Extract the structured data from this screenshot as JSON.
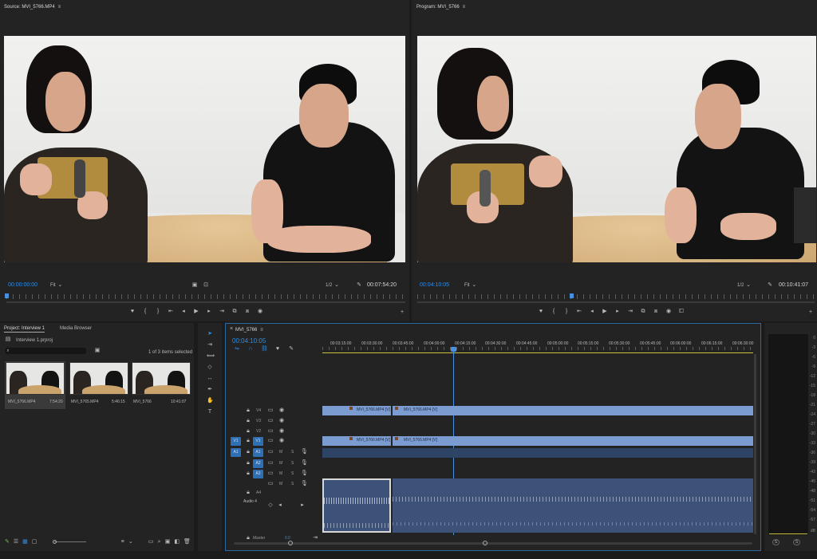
{
  "source": {
    "title": "Source: MVI_5766.MP4",
    "menu_icon": "hamburger-icon",
    "timecode": "00:00:00:00",
    "fit": "Fit",
    "resolution": "1/2",
    "duration": "00:07:54:20"
  },
  "program": {
    "title": "Program: MVI_5766",
    "menu_icon": "hamburger-icon",
    "timecode": "00:04:10:05",
    "fit": "Fit",
    "resolution": "1/2",
    "duration": "00:10:41:07"
  },
  "project": {
    "tab_project": "Project: Interview 1",
    "tab_media": "Media Browser",
    "filename": "Interview 1.prproj",
    "selection": "1 of 3 items selected",
    "items": [
      {
        "name": "MVI_5766.MP4",
        "duration": "7:54:20"
      },
      {
        "name": "MVI_5765.MP4",
        "duration": "5:46:15"
      },
      {
        "name": "MVI_5766",
        "duration": "10:41:07"
      }
    ]
  },
  "timeline": {
    "tab": "MVI_5766",
    "timecode": "00:04:10:05",
    "ruler": [
      "00:03:15:00",
      "00:03:30:00",
      "00:03:45:00",
      "00:04:00:00",
      "00:04:15:00",
      "00:04:30:00",
      "00:04:45:00",
      "00:05:00:00",
      "00:05:15:00",
      "00:05:30:00",
      "00:05:45:00",
      "00:06:00:00",
      "00:06:15:00",
      "00:06:30:00"
    ],
    "video_tracks": [
      "V4",
      "V3",
      "V2",
      "V1"
    ],
    "audio_tracks": [
      "A1",
      "A2",
      "A3"
    ],
    "src_v": "V1",
    "src_a": "A1",
    "v4_clip_a": "MVI_5766.MP4 [V]",
    "v4_clip_b": "MVI_5766.MP4 [V]",
    "v1_clip_a": "MVI_5766.MP4 [V]",
    "v1_clip_b": "MVI_5766.MP4 [V]",
    "a4_label": "A4",
    "a4_name": "Audio 4",
    "master_label": "Master",
    "master_value": "0.0",
    "m_label": "M",
    "s_label": "S"
  },
  "meter": {
    "scale": [
      "0",
      "-3",
      "-6",
      "-9",
      "-12",
      "-15",
      "-18",
      "-21",
      "-24",
      "-27",
      "-30",
      "-33",
      "-36",
      "-39",
      "-42",
      "-45",
      "-48",
      "-51",
      "-54",
      "-57",
      "dB"
    ],
    "solo_left": "S",
    "solo_right": "S"
  },
  "colors": {
    "accent": "#2f8de4",
    "clip": "#7b9cd1",
    "audio": "#3c5278",
    "playhead": "#4a90e2"
  }
}
